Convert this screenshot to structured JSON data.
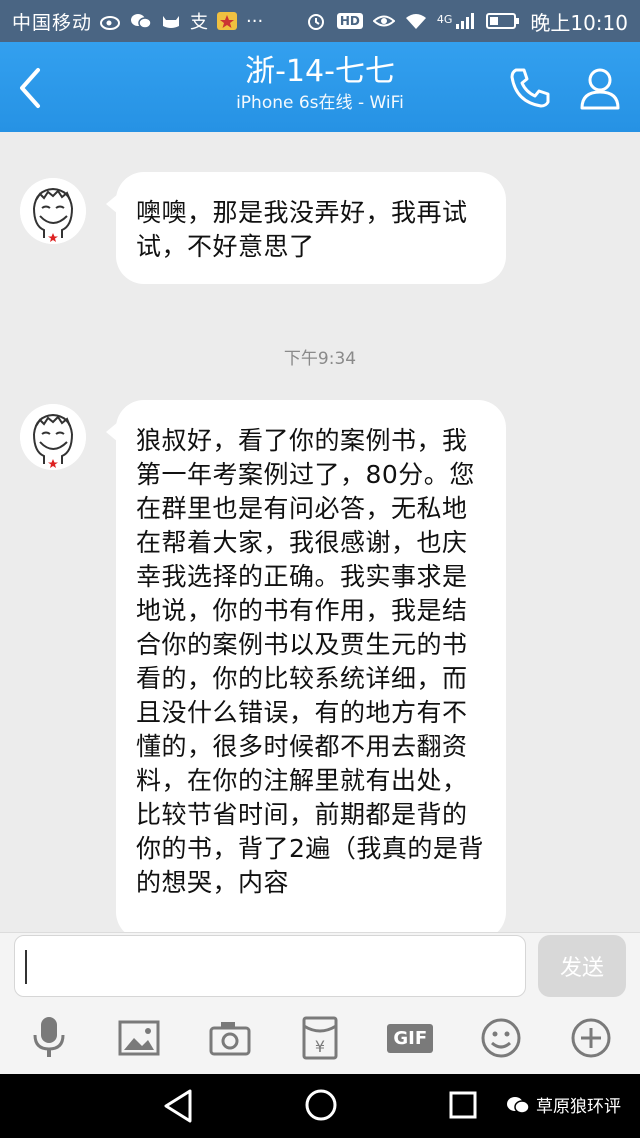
{
  "status_bar": {
    "carrier": "中国移动",
    "network": "4G",
    "time": "晚上10:10",
    "icons": [
      "weibo-icon",
      "wechat-icon",
      "cat-icon",
      "alipay-icon",
      "star-icon",
      "more-icon",
      "alarm-icon",
      "hd-icon",
      "eye-icon",
      "wifi-icon",
      "signal-icon",
      "battery-icon"
    ],
    "hd_label": "HD",
    "alipay_label": "支"
  },
  "header": {
    "title": "浙-14-七七",
    "subtitle": "iPhone 6s在线 - WiFi",
    "color": "#2b96e8"
  },
  "chat": {
    "cut_timestamp": "",
    "messages": [
      {
        "text": "噢噢，那是我没弄好，我再试试，不好意思了"
      },
      {
        "timestamp": "下午9:34",
        "text": "狼叔好，看了你的案例书，我第一年考案例过了，80分。您在群里也是有问必答，无私地在帮着大家，我很感谢，也庆幸我选择的正确。我实事求是地说，你的书有作用，我是结合你的案例书以及贾生元的书看的，你的比较系统详细，而且没什么错误，有的地方有不懂的，很多时候都不用去翻资料，在你的注解里就有出处，比较节省时间，前期都是背的你的书，背了2遍（我真的是背的想哭，内容"
      }
    ]
  },
  "input": {
    "placeholder": "",
    "send_label": "发送"
  },
  "toolbar": {
    "items": [
      "microphone-icon",
      "image-icon",
      "camera-icon",
      "red-packet-icon",
      "gif-icon",
      "emoji-icon",
      "plus-icon"
    ],
    "gif_label": "GIF",
    "red_packet_label": "¥"
  },
  "navbar": {
    "watermark": "草原狼环评"
  }
}
